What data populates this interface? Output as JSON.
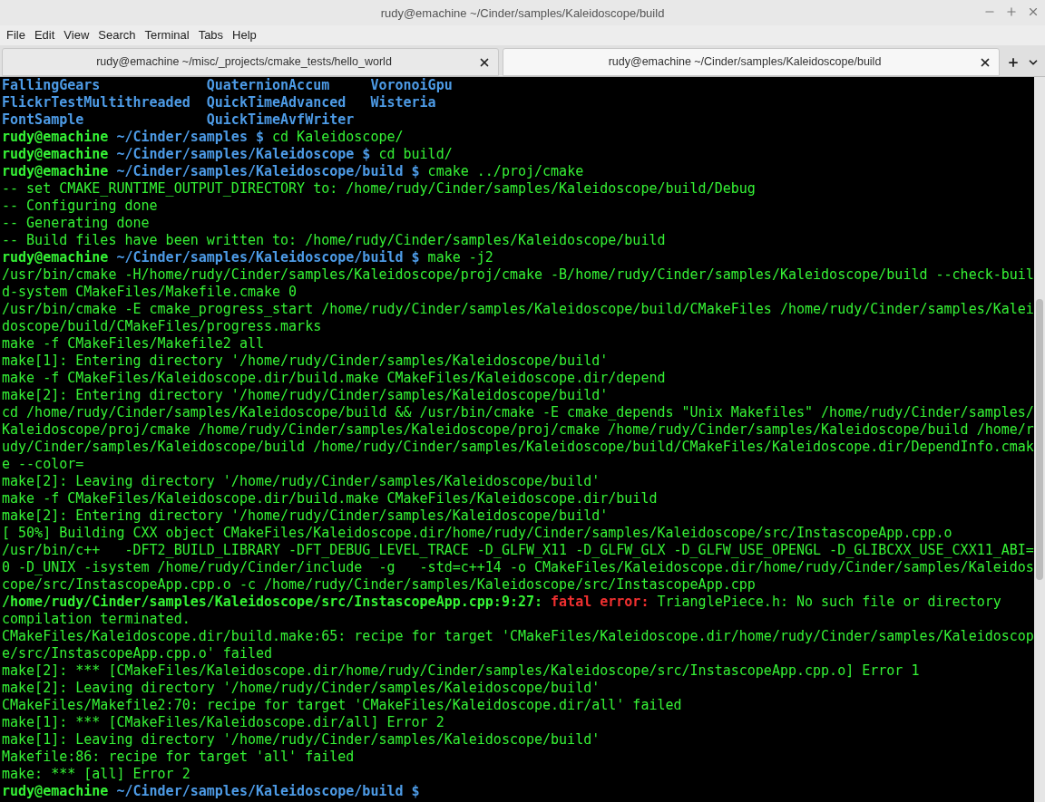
{
  "window": {
    "title": "rudy@emachine ~/Cinder/samples/Kaleidoscope/build"
  },
  "menu": [
    "File",
    "Edit",
    "View",
    "Search",
    "Terminal",
    "Tabs",
    "Help"
  ],
  "tabs": [
    {
      "label": "rudy@emachine ~/misc/_projects/cmake_tests/hello_world",
      "selected": false
    },
    {
      "label": "rudy@emachine ~/Cinder/samples/Kaleidoscope/build",
      "selected": true
    }
  ],
  "terminal_lines": [
    [
      {
        "kind": "listing",
        "text": "FallingGears             QuaternionAccum     VoronoiGpu"
      }
    ],
    [
      {
        "kind": "listing",
        "text": "FlickrTestMultithreaded  QuickTimeAdvanced   Wisteria"
      }
    ],
    [
      {
        "kind": "listing",
        "text": "FontSample               QuickTimeAvfWriter"
      }
    ],
    [
      {
        "kind": "user",
        "text": "rudy@emachine"
      },
      {
        "kind": "path",
        "text": " ~/Cinder/samples $"
      },
      {
        "kind": "plain",
        "text": " cd Kaleidoscope/"
      }
    ],
    [
      {
        "kind": "user",
        "text": "rudy@emachine"
      },
      {
        "kind": "path",
        "text": " ~/Cinder/samples/Kaleidoscope $"
      },
      {
        "kind": "plain",
        "text": " cd build/"
      }
    ],
    [
      {
        "kind": "user",
        "text": "rudy@emachine"
      },
      {
        "kind": "path",
        "text": " ~/Cinder/samples/Kaleidoscope/build $"
      },
      {
        "kind": "plain",
        "text": " cmake ../proj/cmake"
      }
    ],
    [
      {
        "kind": "plain",
        "text": "-- set CMAKE_RUNTIME_OUTPUT_DIRECTORY to: /home/rudy/Cinder/samples/Kaleidoscope/build/Debug"
      }
    ],
    [
      {
        "kind": "plain",
        "text": "-- Configuring done"
      }
    ],
    [
      {
        "kind": "plain",
        "text": "-- Generating done"
      }
    ],
    [
      {
        "kind": "plain",
        "text": "-- Build files have been written to: /home/rudy/Cinder/samples/Kaleidoscope/build"
      }
    ],
    [
      {
        "kind": "user",
        "text": "rudy@emachine"
      },
      {
        "kind": "path",
        "text": " ~/Cinder/samples/Kaleidoscope/build $"
      },
      {
        "kind": "plain",
        "text": " make -j2"
      }
    ],
    [
      {
        "kind": "plain",
        "text": "/usr/bin/cmake -H/home/rudy/Cinder/samples/Kaleidoscope/proj/cmake -B/home/rudy/Cinder/samples/Kaleidoscope/build --check-buil"
      }
    ],
    [
      {
        "kind": "plain",
        "text": "d-system CMakeFiles/Makefile.cmake 0"
      }
    ],
    [
      {
        "kind": "plain",
        "text": "/usr/bin/cmake -E cmake_progress_start /home/rudy/Cinder/samples/Kaleidoscope/build/CMakeFiles /home/rudy/Cinder/samples/Kalei"
      }
    ],
    [
      {
        "kind": "plain",
        "text": "doscope/build/CMakeFiles/progress.marks"
      }
    ],
    [
      {
        "kind": "plain",
        "text": "make -f CMakeFiles/Makefile2 all"
      }
    ],
    [
      {
        "kind": "plain",
        "text": "make[1]: Entering directory '/home/rudy/Cinder/samples/Kaleidoscope/build'"
      }
    ],
    [
      {
        "kind": "plain",
        "text": "make -f CMakeFiles/Kaleidoscope.dir/build.make CMakeFiles/Kaleidoscope.dir/depend"
      }
    ],
    [
      {
        "kind": "plain",
        "text": "make[2]: Entering directory '/home/rudy/Cinder/samples/Kaleidoscope/build'"
      }
    ],
    [
      {
        "kind": "plain",
        "text": "cd /home/rudy/Cinder/samples/Kaleidoscope/build && /usr/bin/cmake -E cmake_depends \"Unix Makefiles\" /home/rudy/Cinder/samples/"
      }
    ],
    [
      {
        "kind": "plain",
        "text": "Kaleidoscope/proj/cmake /home/rudy/Cinder/samples/Kaleidoscope/proj/cmake /home/rudy/Cinder/samples/Kaleidoscope/build /home/r"
      }
    ],
    [
      {
        "kind": "plain",
        "text": "udy/Cinder/samples/Kaleidoscope/build /home/rudy/Cinder/samples/Kaleidoscope/build/CMakeFiles/Kaleidoscope.dir/DependInfo.cmak"
      }
    ],
    [
      {
        "kind": "plain",
        "text": "e --color="
      }
    ],
    [
      {
        "kind": "plain",
        "text": "make[2]: Leaving directory '/home/rudy/Cinder/samples/Kaleidoscope/build'"
      }
    ],
    [
      {
        "kind": "plain",
        "text": "make -f CMakeFiles/Kaleidoscope.dir/build.make CMakeFiles/Kaleidoscope.dir/build"
      }
    ],
    [
      {
        "kind": "plain",
        "text": "make[2]: Entering directory '/home/rudy/Cinder/samples/Kaleidoscope/build'"
      }
    ],
    [
      {
        "kind": "plain",
        "text": "[ 50%] Building CXX object CMakeFiles/Kaleidoscope.dir/home/rudy/Cinder/samples/Kaleidoscope/src/InstascopeApp.cpp.o"
      }
    ],
    [
      {
        "kind": "plain",
        "text": "/usr/bin/c++   -DFT2_BUILD_LIBRARY -DFT_DEBUG_LEVEL_TRACE -D_GLFW_X11 -D_GLFW_GLX -D_GLFW_USE_OPENGL -D_GLIBCXX_USE_CXX11_ABI="
      }
    ],
    [
      {
        "kind": "plain",
        "text": "0 -D_UNIX -isystem /home/rudy/Cinder/include  -g   -std=c++14 -o CMakeFiles/Kaleidoscope.dir/home/rudy/Cinder/samples/Kaleidos"
      }
    ],
    [
      {
        "kind": "plain",
        "text": "cope/src/InstascopeApp.cpp.o -c /home/rudy/Cinder/samples/Kaleidoscope/src/InstascopeApp.cpp"
      }
    ],
    [
      {
        "kind": "user",
        "text": "/home/rudy/Cinder/samples/Kaleidoscope/src/InstascopeApp.cpp:9:27:"
      },
      {
        "kind": "error",
        "text": " fatal error:"
      },
      {
        "kind": "plain",
        "text": " TrianglePiece.h: No such file or directory"
      }
    ],
    [
      {
        "kind": "plain",
        "text": "compilation terminated."
      }
    ],
    [
      {
        "kind": "plain",
        "text": "CMakeFiles/Kaleidoscope.dir/build.make:65: recipe for target 'CMakeFiles/Kaleidoscope.dir/home/rudy/Cinder/samples/Kaleidoscop"
      }
    ],
    [
      {
        "kind": "plain",
        "text": "e/src/InstascopeApp.cpp.o' failed"
      }
    ],
    [
      {
        "kind": "plain",
        "text": "make[2]: *** [CMakeFiles/Kaleidoscope.dir/home/rudy/Cinder/samples/Kaleidoscope/src/InstascopeApp.cpp.o] Error 1"
      }
    ],
    [
      {
        "kind": "plain",
        "text": "make[2]: Leaving directory '/home/rudy/Cinder/samples/Kaleidoscope/build'"
      }
    ],
    [
      {
        "kind": "plain",
        "text": "CMakeFiles/Makefile2:70: recipe for target 'CMakeFiles/Kaleidoscope.dir/all' failed"
      }
    ],
    [
      {
        "kind": "plain",
        "text": "make[1]: *** [CMakeFiles/Kaleidoscope.dir/all] Error 2"
      }
    ],
    [
      {
        "kind": "plain",
        "text": "make[1]: Leaving directory '/home/rudy/Cinder/samples/Kaleidoscope/build'"
      }
    ],
    [
      {
        "kind": "plain",
        "text": "Makefile:86: recipe for target 'all' failed"
      }
    ],
    [
      {
        "kind": "plain",
        "text": "make: *** [all] Error 2"
      }
    ],
    [
      {
        "kind": "user",
        "text": "rudy@emachine"
      },
      {
        "kind": "path",
        "text": " ~/Cinder/samples/Kaleidoscope/build $"
      }
    ]
  ]
}
